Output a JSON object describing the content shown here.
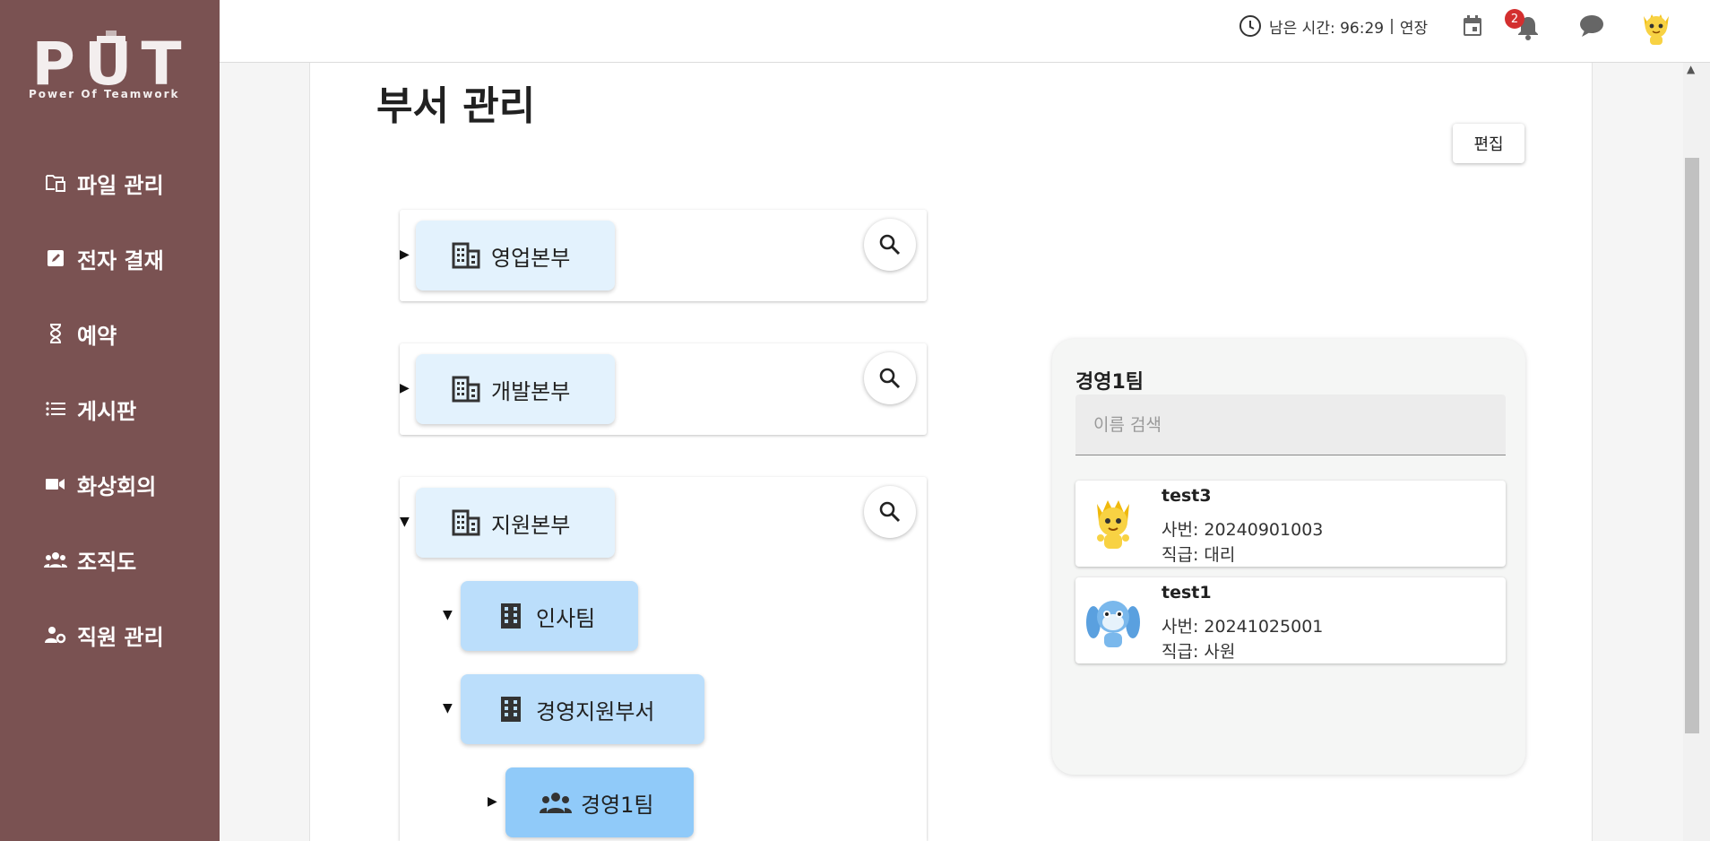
{
  "app": {
    "logo_text": "PUT",
    "logo_tagline": "Power Of Teamwork"
  },
  "sidebar": {
    "items": [
      {
        "label": "파일 관리",
        "icon": "file-folder-icon"
      },
      {
        "label": "전자 결재",
        "icon": "edit-icon"
      },
      {
        "label": "예약",
        "icon": "hourglass-icon"
      },
      {
        "label": "게시판",
        "icon": "list-icon"
      },
      {
        "label": "화상회의",
        "icon": "video-camera-icon"
      },
      {
        "label": "조직도",
        "icon": "group-icon"
      },
      {
        "label": "직원 관리",
        "icon": "person-gear-icon"
      }
    ]
  },
  "topbar": {
    "timer_label": "남은 시간: 96:29",
    "separator": "|",
    "extend_label": "연장",
    "notification_count": "2"
  },
  "page": {
    "title": "부서 관리",
    "edit_label": "편집"
  },
  "tree": {
    "sales": "영업본부",
    "dev": "개발본부",
    "support": "지원본부",
    "hr": "인사팀",
    "mgmt_support": "경영지원부서",
    "mgmt1": "경영1팀"
  },
  "panel": {
    "title": "경영1팀",
    "search_placeholder": "이름 검색",
    "members": [
      {
        "name": "test3",
        "emp_no": "사번: 20240901003",
        "position": "직급: 대리",
        "avatar": "yellow-character"
      },
      {
        "name": "test1",
        "emp_no": "사번: 20241025001",
        "position": "직급: 사원",
        "avatar": "blue-character"
      }
    ]
  },
  "colors": {
    "sidebar": "#7a5252",
    "chip_level0": "#e3f2fd",
    "chip_level1": "#bbdefb",
    "chip_level2": "#90caf9",
    "badge": "#d32f2f"
  }
}
